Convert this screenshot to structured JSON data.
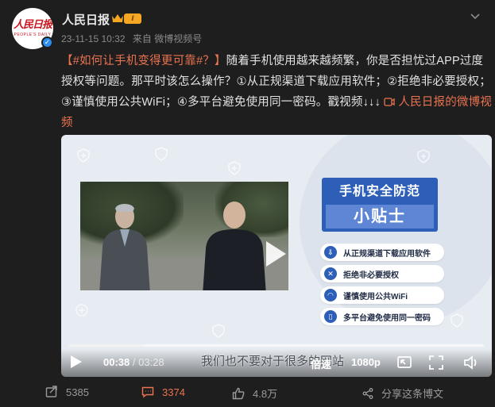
{
  "account": {
    "name": "人民日报",
    "logo_text": "人民日报",
    "logo_sub": "PEOPLE'S DAILY",
    "level": "Ⅰ",
    "timestamp": "23-11-15 10:32",
    "source": "来自 微博视频号"
  },
  "post": {
    "hashtag": "【#如何让手机变得更可靠#？】",
    "body": "随着手机使用越来越频繁，你是否担忧过APP过度授权等问题。那平时该怎么操作？①从正规渠道下载应用软件；②拒绝非必要授权；③谨慎使用公共WiFi；④多平台避免使用同一密码。戳视频↓↓↓",
    "link": "人民日报的微博视频"
  },
  "video": {
    "tips_title": "手机安全防范",
    "tips_subtitle": "小贴士",
    "tips": [
      "从正规渠道下载应用软件",
      "拒绝非必要授权",
      "谨慎使用公共WiFi",
      "多平台避免使用同一密码"
    ],
    "caption": "我们也不要对于很多的网站",
    "current_time": "00:38",
    "separator": "/",
    "duration": "03:28",
    "progress": 0.18,
    "speed_label": "倍速",
    "quality_label": "1080p"
  },
  "footer": {
    "reposts": "5385",
    "comments": "3374",
    "likes": "4.8万",
    "share_label": "分享这条博文"
  },
  "colors": {
    "accent": "#eb7350",
    "tips_blue": "#2e5fb8"
  }
}
